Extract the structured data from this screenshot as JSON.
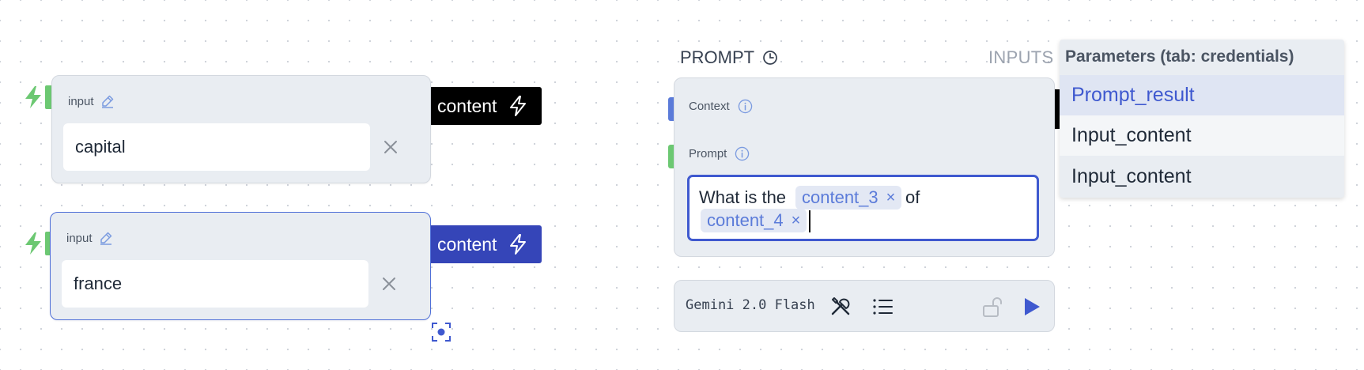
{
  "input_nodes": [
    {
      "label": "input",
      "value": "capital",
      "output_label": "content",
      "selected": false
    },
    {
      "label": "input",
      "value": "france",
      "output_label": "content",
      "selected": true
    }
  ],
  "prompt_node": {
    "title": "PROMPT",
    "inputs_label": "INPUTS",
    "context_label": "Context",
    "prompt_label": "Prompt",
    "text_before": "What is the",
    "chip1": "content_3",
    "text_mid": "of",
    "chip2": "content_4",
    "chip_remove": "×",
    "model": "Gemini 2.0 Flash"
  },
  "dropdown": {
    "header": "Parameters (tab: credentials)",
    "items": [
      "Prompt_result",
      "Input_content",
      "Input_content"
    ],
    "active_index": 0
  },
  "colors": {
    "accent": "#3f59cf",
    "handle_green": "#6cc872",
    "handle_blue": "#5b7bd9",
    "output_black": "#000000",
    "output_blue": "#3545b8"
  }
}
